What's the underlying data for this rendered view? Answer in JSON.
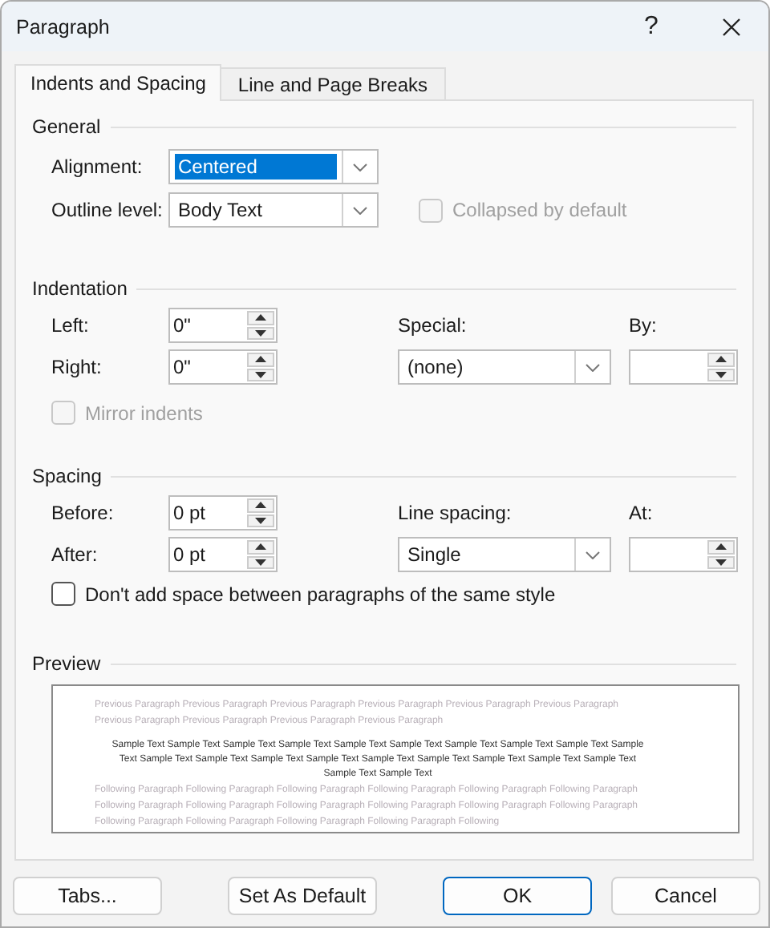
{
  "window": {
    "title": "Paragraph",
    "help": "?"
  },
  "tabs": [
    {
      "label": "Indents and Spacing",
      "selected": true
    },
    {
      "label": "Line and Page Breaks",
      "selected": false
    }
  ],
  "general": {
    "heading": "General",
    "alignment": {
      "label": "Alignment:",
      "value": "Centered",
      "highlighted": true
    },
    "outline_level": {
      "label": "Outline level:",
      "value": "Body Text",
      "highlighted": false
    },
    "collapsed": {
      "label": "Collapsed by default",
      "checked": false,
      "disabled": true
    }
  },
  "indentation": {
    "heading": "Indentation",
    "left": {
      "label": "Left:",
      "value": "0\""
    },
    "right": {
      "label": "Right:",
      "value": "0\""
    },
    "special": {
      "label": "Special:",
      "value": "(none)",
      "highlighted": false
    },
    "by": {
      "label": "By:"
    },
    "mirror": {
      "label": "Mirror indents",
      "checked": false,
      "disabled": true
    }
  },
  "spacing": {
    "heading": "Spacing",
    "before": {
      "label": "Before:",
      "value": "0 pt"
    },
    "after": {
      "label": "After:",
      "value": "0 pt"
    },
    "line_spacing": {
      "label": "Line spacing:",
      "value": "Single",
      "highlighted": false
    },
    "at": {
      "label": "At:"
    },
    "dont_add": {
      "label": "Don't add space between paragraphs of the same style",
      "checked": false,
      "disabled": false
    }
  },
  "preview": {
    "heading": "Preview",
    "previous": "Previous Paragraph Previous Paragraph Previous Paragraph Previous Paragraph Previous Paragraph Previous Paragraph Previous Paragraph Previous Paragraph Previous Paragraph Previous Paragraph",
    "sample": "Sample Text Sample Text Sample Text Sample Text Sample Text Sample Text Sample Text Sample Text Sample Text Sample Text Sample Text Sample Text Sample Text Sample Text Sample Text Sample Text Sample Text Sample Text Sample Text Sample Text Sample Text",
    "following": "Following Paragraph Following Paragraph Following Paragraph Following Paragraph Following Paragraph Following Paragraph Following Paragraph Following Paragraph Following Paragraph Following Paragraph Following Paragraph Following Paragraph Following Paragraph Following Paragraph Following Paragraph Following Paragraph Following"
  },
  "buttons": [
    {
      "label": "Tabs...",
      "default": false
    },
    {
      "label": "Set As Default",
      "default": false
    },
    {
      "label": "OK",
      "default": true
    },
    {
      "label": "Cancel",
      "default": false
    }
  ]
}
